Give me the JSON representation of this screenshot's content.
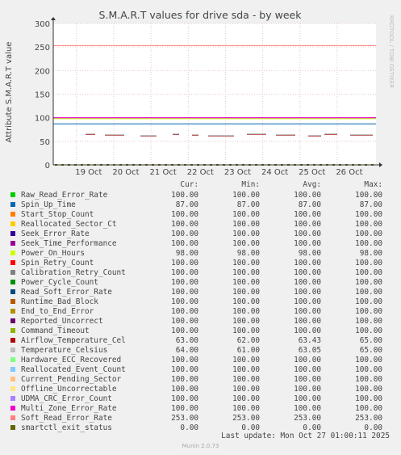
{
  "colors": {
    "background": "#f0f0f0",
    "plot_background": "#ffffff",
    "grid": "#e0b0b0",
    "axis_text": "#444444"
  },
  "watermark": "RRDTOOL / TOBI OETIKER",
  "legend_headers": {
    "cur": "Cur:",
    "min": "Min:",
    "avg": "Avg:",
    "max": "Max:"
  },
  "last_update": "Last update: Mon Oct 27 01:00:11 2025",
  "footer": "Munin 2.0.73",
  "chart_data": {
    "type": "line",
    "title": "S.M.A.R.T values for drive sda - by week",
    "xlabel": "",
    "ylabel": "Attribute S.M.A.R.T value",
    "ylim": [
      0,
      300
    ],
    "yticks": [
      0,
      50,
      100,
      150,
      200,
      250,
      300
    ],
    "x_range": [
      "2025-10-18 09:00",
      "2025-10-27 01:00"
    ],
    "xticks": [
      "19 Oct",
      "20 Oct",
      "21 Oct",
      "22 Oct",
      "23 Oct",
      "24 Oct",
      "25 Oct",
      "26 Oct"
    ],
    "grid": true,
    "series": [
      {
        "name": "Raw_Read_Error_Rate",
        "color": "#00cc00",
        "cur": "100.00",
        "min": "100.00",
        "avg": "100.00",
        "max": "100.00",
        "value": 100
      },
      {
        "name": "Spin_Up_Time",
        "color": "#0066b3",
        "cur": "87.00",
        "min": "87.00",
        "avg": "87.00",
        "max": "87.00",
        "value": 87
      },
      {
        "name": "Start_Stop_Count",
        "color": "#ff8000",
        "cur": "100.00",
        "min": "100.00",
        "avg": "100.00",
        "max": "100.00",
        "value": 100
      },
      {
        "name": "Reallocated_Sector_Ct",
        "color": "#ffcc00",
        "cur": "100.00",
        "min": "100.00",
        "avg": "100.00",
        "max": "100.00",
        "value": 100
      },
      {
        "name": "Seek_Error_Rate",
        "color": "#330099",
        "cur": "100.00",
        "min": "100.00",
        "avg": "100.00",
        "max": "100.00",
        "value": 100
      },
      {
        "name": "Seek_Time_Performance",
        "color": "#990099",
        "cur": "100.00",
        "min": "100.00",
        "avg": "100.00",
        "max": "100.00",
        "value": 100
      },
      {
        "name": "Power_On_Hours",
        "color": "#ccff00",
        "cur": "98.00",
        "min": "98.00",
        "avg": "98.00",
        "max": "98.00",
        "value": 98
      },
      {
        "name": "Spin_Retry_Count",
        "color": "#ff0000",
        "cur": "100.00",
        "min": "100.00",
        "avg": "100.00",
        "max": "100.00",
        "value": 100
      },
      {
        "name": "Calibration_Retry_Count",
        "color": "#808080",
        "cur": "100.00",
        "min": "100.00",
        "avg": "100.00",
        "max": "100.00",
        "value": 100
      },
      {
        "name": "Power_Cycle_Count",
        "color": "#008f00",
        "cur": "100.00",
        "min": "100.00",
        "avg": "100.00",
        "max": "100.00",
        "value": 100
      },
      {
        "name": "Read_Soft_Error_Rate",
        "color": "#00487d",
        "cur": "100.00",
        "min": "100.00",
        "avg": "100.00",
        "max": "100.00",
        "value": 100
      },
      {
        "name": "Runtime_Bad_Block",
        "color": "#b35a00",
        "cur": "100.00",
        "min": "100.00",
        "avg": "100.00",
        "max": "100.00",
        "value": 100
      },
      {
        "name": "End_to_End_Error",
        "color": "#b38f00",
        "cur": "100.00",
        "min": "100.00",
        "avg": "100.00",
        "max": "100.00",
        "value": 100
      },
      {
        "name": "Reported_Uncorrect",
        "color": "#6b006b",
        "cur": "100.00",
        "min": "100.00",
        "avg": "100.00",
        "max": "100.00",
        "value": 100
      },
      {
        "name": "Command_Timeout",
        "color": "#8fb300",
        "cur": "100.00",
        "min": "100.00",
        "avg": "100.00",
        "max": "100.00",
        "value": 100
      },
      {
        "name": "Airflow_Temperature_Cel",
        "color": "#b30000",
        "cur": "63.00",
        "min": "62.00",
        "avg": "63.43",
        "max": "65.00",
        "value": 63
      },
      {
        "name": "Temperature_Celsius",
        "color": "#bebebe",
        "cur": "64.00",
        "min": "61.00",
        "avg": "63.05",
        "max": "65.00",
        "value": 64
      },
      {
        "name": "Hardware_ECC_Recovered",
        "color": "#80ff80",
        "cur": "100.00",
        "min": "100.00",
        "avg": "100.00",
        "max": "100.00",
        "value": 100
      },
      {
        "name": "Reallocated_Event_Count",
        "color": "#80c9ff",
        "cur": "100.00",
        "min": "100.00",
        "avg": "100.00",
        "max": "100.00",
        "value": 100
      },
      {
        "name": "Current_Pending_Sector",
        "color": "#ffc080",
        "cur": "100.00",
        "min": "100.00",
        "avg": "100.00",
        "max": "100.00",
        "value": 100
      },
      {
        "name": "Offline_Uncorrectable",
        "color": "#ffe680",
        "cur": "100.00",
        "min": "100.00",
        "avg": "100.00",
        "max": "100.00",
        "value": 100
      },
      {
        "name": "UDMA_CRC_Error_Count",
        "color": "#aa80ff",
        "cur": "100.00",
        "min": "100.00",
        "avg": "100.00",
        "max": "100.00",
        "value": 100
      },
      {
        "name": "Multi_Zone_Error_Rate",
        "color": "#ee00cc",
        "cur": "100.00",
        "min": "100.00",
        "avg": "100.00",
        "max": "100.00",
        "value": 100
      },
      {
        "name": "Soft_Read_Error_Rate",
        "color": "#ff8080",
        "cur": "253.00",
        "min": "253.00",
        "avg": "253.00",
        "max": "253.00",
        "value": 253
      },
      {
        "name": "smartctl_exit_status",
        "color": "#666600",
        "cur": "0.00",
        "min": "0.00",
        "avg": "0.00",
        "max": "0.00",
        "value": 0
      }
    ]
  }
}
